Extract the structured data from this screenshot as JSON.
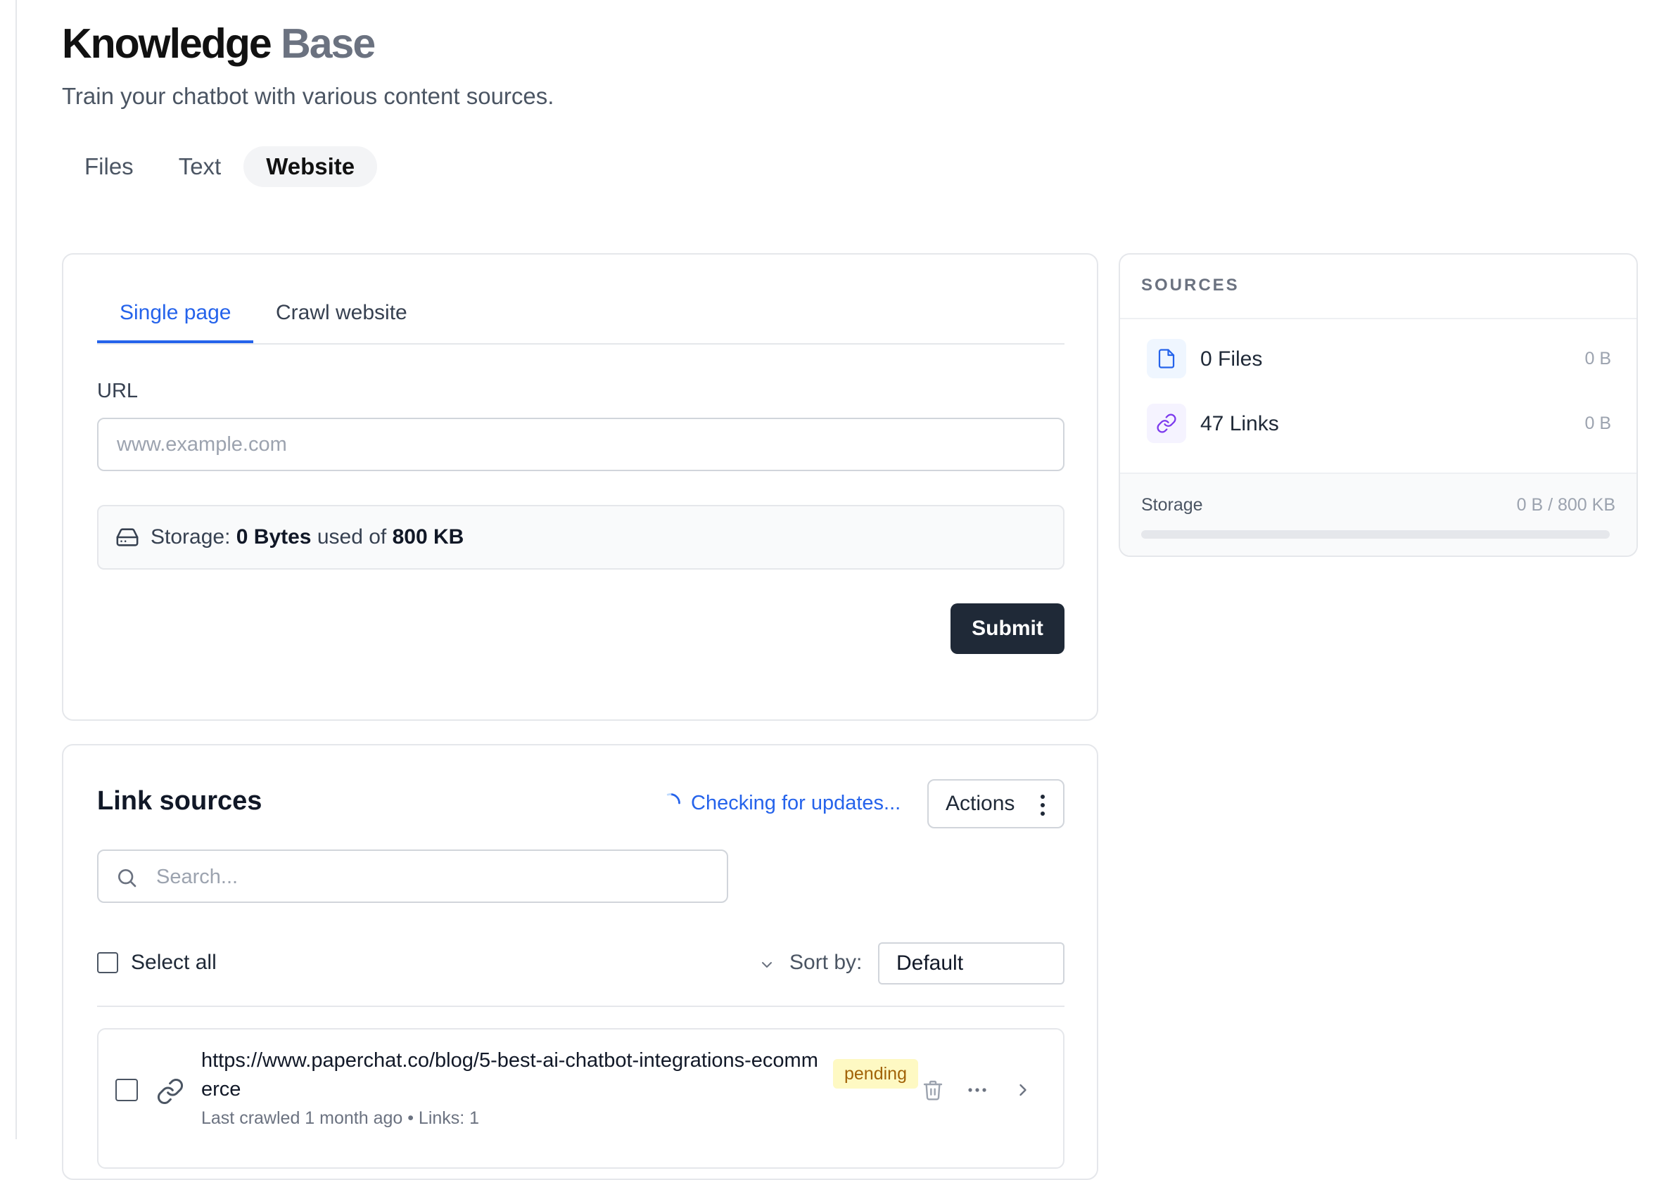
{
  "header": {
    "title_word1": "Knowledge",
    "title_word2": "Base",
    "subtitle": "Train your chatbot with various content sources."
  },
  "tabs": [
    {
      "label": "Files",
      "active": false
    },
    {
      "label": "Text",
      "active": false
    },
    {
      "label": "Website",
      "active": true
    }
  ],
  "website_form": {
    "subtabs": [
      {
        "label": "Single page",
        "active": true
      },
      {
        "label": "Crawl website",
        "active": false
      }
    ],
    "url_label": "URL",
    "url_value": "",
    "url_placeholder": "www.example.com",
    "storage_prefix": "Storage:",
    "storage_used": "0 Bytes",
    "storage_mid": "used of",
    "storage_total": "800 KB",
    "submit_label": "Submit"
  },
  "sources": {
    "title": "SOURCES",
    "items": [
      {
        "icon": "file-icon",
        "label": "0 Files",
        "size": "0 B"
      },
      {
        "icon": "link-icon",
        "label": "47 Links",
        "size": "0 B"
      }
    ],
    "storage_label": "Storage",
    "storage_value": "0 B / 800 KB",
    "storage_fraction": 0
  },
  "link_sources": {
    "title": "Link sources",
    "status_text": "Checking for updates...",
    "actions_label": "Actions",
    "search_placeholder": "Search...",
    "search_value": "",
    "select_all_label": "Select all",
    "sort_label": "Sort by:",
    "sort_value": "Default",
    "items": [
      {
        "url": "https://www.paperchat.co/blog/5-best-ai-chatbot-integrations-ecommerce",
        "meta": "Last crawled 1 month ago • Links: 1",
        "status": "pending"
      }
    ]
  },
  "colors": {
    "accent": "#2563eb",
    "primary_button": "#1f2937",
    "pending_bg": "#fef9c3",
    "pending_text": "#a16207"
  }
}
